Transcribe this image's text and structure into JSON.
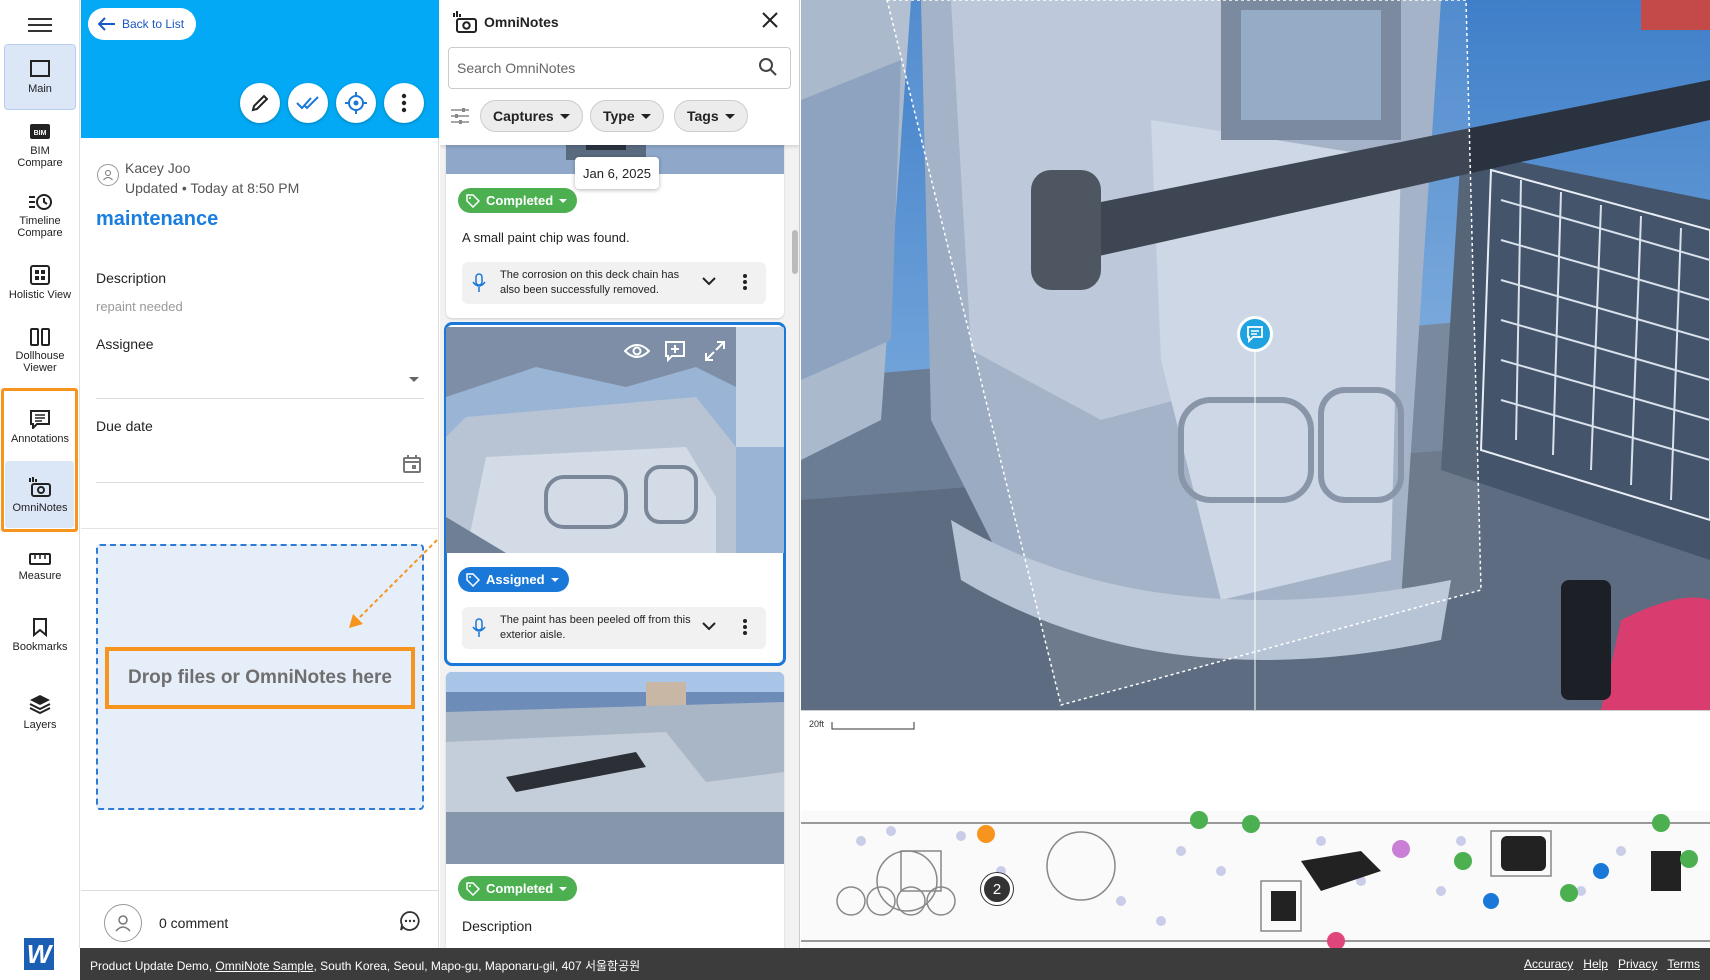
{
  "nav": {
    "items": [
      {
        "label": "Main",
        "icon": "square-icon"
      },
      {
        "label": "BIM\nCompare",
        "icon": "bim-icon"
      },
      {
        "label": "Timeline\nCompare",
        "icon": "timeline-icon"
      },
      {
        "label": "Holistic View",
        "icon": "grid-icon"
      },
      {
        "label": "Dollhouse\nViewer",
        "icon": "dollhouse-icon"
      },
      {
        "label": "Annotations",
        "icon": "annotation-icon"
      },
      {
        "label": "OmniNotes",
        "icon": "omninotes-icon"
      },
      {
        "label": "Measure",
        "icon": "ruler-icon"
      },
      {
        "label": "Bookmarks",
        "icon": "bookmark-icon"
      },
      {
        "label": "Layers",
        "icon": "layers-icon"
      }
    ],
    "logo": "W"
  },
  "detail": {
    "back_label": "Back to List",
    "author": "Kacey Joo",
    "updated": "Updated • Today at 8:50 PM",
    "title": "maintenance",
    "description_label": "Description",
    "description_value": "repaint needed",
    "assignee_label": "Assignee",
    "due_label": "Due date",
    "drop_text": "Drop files or OmniNotes here",
    "comment_count": "0 comment"
  },
  "omni": {
    "title": "OmniNotes",
    "search_placeholder": "Search OmniNotes",
    "chips": [
      "Captures",
      "Type",
      "Tags"
    ],
    "tooltip_date": "Jan 6, 2025",
    "cards": [
      {
        "status": "Completed",
        "desc": "A small paint chip was found.",
        "voice": "The corrosion on this deck chain has also been successfully removed."
      },
      {
        "status": "Assigned",
        "voice": "The paint has been peeled off from this exterior aisle."
      },
      {
        "status": "Completed",
        "desc": "Description"
      }
    ]
  },
  "viewer": {
    "scale_label": "20ft",
    "cluster_count": "2"
  },
  "footer": {
    "prefix": "Product Update Demo, ",
    "link": "OmniNote Sample",
    "address": ", South Korea, Seoul, Mapo-gu, Maponaru-gil, 407 서울함공원",
    "links": [
      "Accuracy",
      "Help",
      "Privacy",
      "Terms"
    ]
  },
  "colors": {
    "header_blue": "#03a9f4",
    "accent_orange": "#f7941d",
    "status_green": "#4caf50",
    "status_blue": "#1a78d8"
  }
}
